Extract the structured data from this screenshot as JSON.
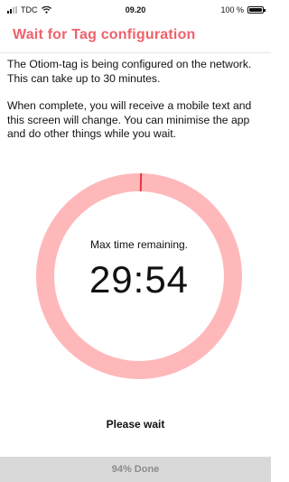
{
  "status_bar": {
    "carrier": "TDC",
    "time": "09.20",
    "battery": "100 %"
  },
  "header": {
    "title": "Wait for Tag configuration"
  },
  "intro": {
    "paragraph1": "The Otiom-tag is being configured on the network. This can take up to 30 minutes.",
    "paragraph2": "When complete, you will receive a mobile text and this screen will change. You can minimise the app and do other things while you wait."
  },
  "timer": {
    "label": "Max time remaining.",
    "value": "29:54",
    "elapsed_fraction": 0.003,
    "ring_color": "#ffb8ba",
    "marker_color": "#e8343f"
  },
  "status": {
    "wait_text": "Please wait",
    "progress_label": "94% Done"
  },
  "colors": {
    "accent": "#f0616b"
  }
}
